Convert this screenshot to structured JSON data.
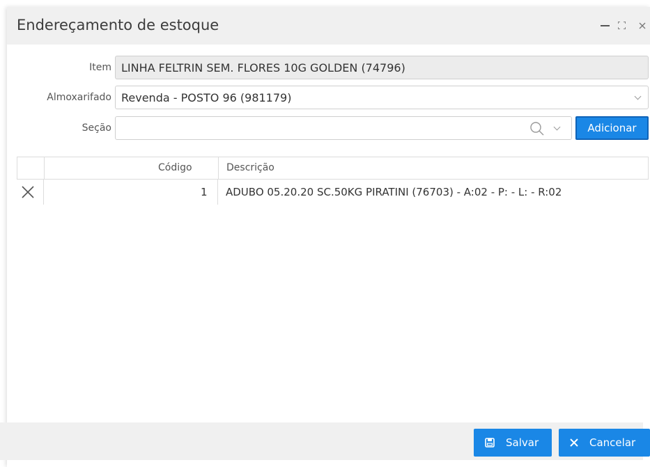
{
  "window": {
    "title": "Endereçamento de estoque"
  },
  "form": {
    "item_label": "Item",
    "item_value": "LINHA FELTRIN SEM. FLORES 10G GOLDEN (74796)",
    "almox_label": "Almoxarifado",
    "almox_value": "Revenda - POSTO 96 (981179)",
    "secao_label": "Seção",
    "secao_value": "",
    "add_button": "Adicionar"
  },
  "grid": {
    "columns": [
      "",
      "Código",
      "Descrição"
    ],
    "rows": [
      {
        "codigo": "1",
        "descricao": "ADUBO 05.20.20 SC.50KG PIRATINI (76703) - A:02 - P: - L: - R:02"
      }
    ]
  },
  "footer": {
    "save_label": "Salvar",
    "cancel_label": "Cancelar"
  },
  "colors": {
    "accent": "#1a87e6",
    "titlebar": "#f0f0f0"
  },
  "icons": [
    "minimize-icon",
    "maximize-icon",
    "close-icon",
    "search-icon",
    "chevron-down-icon",
    "delete-row-icon",
    "save-icon",
    "cancel-icon"
  ]
}
